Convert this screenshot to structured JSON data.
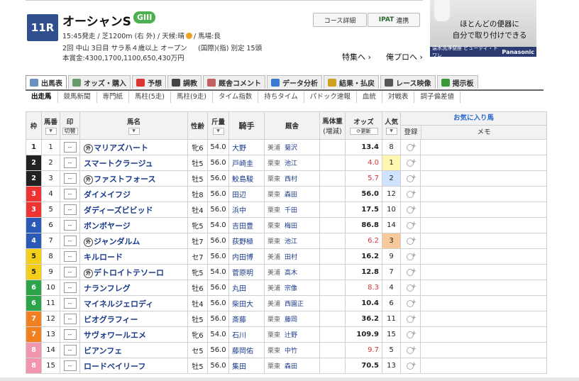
{
  "race": {
    "number": "11R",
    "name": "オーシャンS",
    "grade": "GIII",
    "line1": "15:45発走 / 芝1200m (右 外) / 天候:晴",
    "line1_track": "/ 馬場:良",
    "line2": "2回 中山 3日目 サラ系４歳以上 オープン 　 (国際)(指) 別定 15頭",
    "line3": "本賞金:4300,1700,1100,650,430万円",
    "course_button": "コース詳細",
    "ipat_label": "IPAT",
    "ipat_suffix": "連携",
    "link_special": "特集へ",
    "link_pro": "俺プロへ"
  },
  "ad": {
    "text_line1": "ほとんどの便器に",
    "text_line2": "自分で取り付けできる",
    "bar_left": "温水洗浄便座 ビューティ・トワレ",
    "bar_right": "Panasonic"
  },
  "tabs": [
    {
      "label": "出馬表",
      "color": "#6a8fc0"
    },
    {
      "label": "オッズ・購入",
      "color": "#6a9a6a"
    },
    {
      "label": "予想",
      "color": "#d33"
    },
    {
      "label": "調教",
      "color": "#444"
    },
    {
      "label": "厩舎コメント",
      "color": "#c06060"
    },
    {
      "label": "データ分析",
      "color": "#3a7ad0"
    },
    {
      "label": "結果・払戻",
      "color": "#d0a020"
    },
    {
      "label": "レース映像",
      "color": "#555"
    },
    {
      "label": "掲示板",
      "color": "#3a9a3a"
    }
  ],
  "subnav": [
    "出走馬",
    "競馬新聞",
    "専門紙",
    "馬柱(5走)",
    "馬柱(9走)",
    "タイム指数",
    "持ちタイム",
    "パドック速報",
    "血統",
    "対戦表",
    "調子偏差値"
  ],
  "headers": {
    "waku": "枠",
    "umaban": "馬番",
    "mark": "印",
    "mark_sub": "切替",
    "name": "馬名",
    "sexage": "性齢",
    "weight": "斤量",
    "jockey": "騎手",
    "trainer": "厩舎",
    "body": "馬体重",
    "body_sub": "(増減)",
    "odds": "オッズ",
    "odds_update": "更新",
    "pop": "人気",
    "favorite": "お気に入り馬",
    "register": "登録",
    "memo": "メモ"
  },
  "mark_value": "--",
  "horses": [
    {
      "waku": "1",
      "umaban": "1",
      "maru": "外",
      "name": "マリアズハート",
      "sexage": "牝6",
      "weight": "54.0",
      "jockey": "大野",
      "region": "美浦",
      "trainer": "菊沢",
      "odds": "13.4",
      "pop": "8"
    },
    {
      "waku": "2",
      "umaban": "2",
      "maru": "",
      "name": "スマートクラージュ",
      "sexage": "牡5",
      "weight": "56.0",
      "jockey": "戸崎圭",
      "region": "栗東",
      "trainer": "池江",
      "odds": "4.0",
      "pop": "1"
    },
    {
      "waku": "2",
      "umaban": "3",
      "maru": "外",
      "name": "ファストフォース",
      "sexage": "牡5",
      "weight": "56.0",
      "jockey": "鮫島駿",
      "region": "栗東",
      "trainer": "西村",
      "odds": "5.7",
      "pop": "2"
    },
    {
      "waku": "3",
      "umaban": "4",
      "maru": "",
      "name": "ダイメイフジ",
      "sexage": "牡8",
      "weight": "56.0",
      "jockey": "田辺",
      "region": "栗東",
      "trainer": "森田",
      "odds": "56.0",
      "pop": "12"
    },
    {
      "waku": "3",
      "umaban": "5",
      "maru": "",
      "name": "ダディーズビビッド",
      "sexage": "牡4",
      "weight": "56.0",
      "jockey": "浜中",
      "region": "栗東",
      "trainer": "千田",
      "odds": "17.5",
      "pop": "10"
    },
    {
      "waku": "4",
      "umaban": "6",
      "maru": "",
      "name": "ボンボヤージ",
      "sexage": "牝5",
      "weight": "54.0",
      "jockey": "吉田豊",
      "region": "栗東",
      "trainer": "梅田",
      "odds": "86.8",
      "pop": "14"
    },
    {
      "waku": "4",
      "umaban": "7",
      "maru": "外",
      "name": "ジャンダルム",
      "sexage": "牡7",
      "weight": "56.0",
      "jockey": "荻野極",
      "region": "栗東",
      "trainer": "池江",
      "odds": "6.2",
      "pop": "3"
    },
    {
      "waku": "5",
      "umaban": "8",
      "maru": "",
      "name": "キルロード",
      "sexage": "セ7",
      "weight": "56.0",
      "jockey": "内田博",
      "region": "美浦",
      "trainer": "田村",
      "odds": "16.2",
      "pop": "9"
    },
    {
      "waku": "5",
      "umaban": "9",
      "maru": "外",
      "name": "デトロイトテソーロ",
      "sexage": "牝5",
      "weight": "54.0",
      "jockey": "菅原明",
      "region": "美浦",
      "trainer": "高木",
      "odds": "12.8",
      "pop": "7"
    },
    {
      "waku": "6",
      "umaban": "10",
      "maru": "",
      "name": "ナランフレグ",
      "sexage": "牡6",
      "weight": "56.0",
      "jockey": "丸田",
      "region": "美浦",
      "trainer": "宗像",
      "odds": "8.3",
      "pop": "4"
    },
    {
      "waku": "6",
      "umaban": "11",
      "maru": "",
      "name": "マイネルジェロディ",
      "sexage": "牡4",
      "weight": "56.0",
      "jockey": "柴田大",
      "region": "美浦",
      "trainer": "西園正",
      "odds": "10.4",
      "pop": "6"
    },
    {
      "waku": "7",
      "umaban": "12",
      "maru": "",
      "name": "ビオグラフィー",
      "sexage": "牡5",
      "weight": "56.0",
      "jockey": "斎藤",
      "region": "栗東",
      "trainer": "藤岡",
      "odds": "36.2",
      "pop": "11"
    },
    {
      "waku": "7",
      "umaban": "13",
      "maru": "",
      "name": "サヴォワールエメ",
      "sexage": "牝6",
      "weight": "54.0",
      "jockey": "石川",
      "region": "栗東",
      "trainer": "辻野",
      "odds": "109.9",
      "pop": "15"
    },
    {
      "waku": "8",
      "umaban": "14",
      "maru": "",
      "name": "ビアンフェ",
      "sexage": "セ5",
      "weight": "56.0",
      "jockey": "藤岡佑",
      "region": "栗東",
      "trainer": "中竹",
      "odds": "9.7",
      "pop": "5"
    },
    {
      "waku": "8",
      "umaban": "15",
      "maru": "",
      "name": "ロードベイリーフ",
      "sexage": "牡5",
      "weight": "56.0",
      "jockey": "集田",
      "region": "栗東",
      "trainer": "森田",
      "odds": "70.5",
      "pop": "13"
    }
  ]
}
